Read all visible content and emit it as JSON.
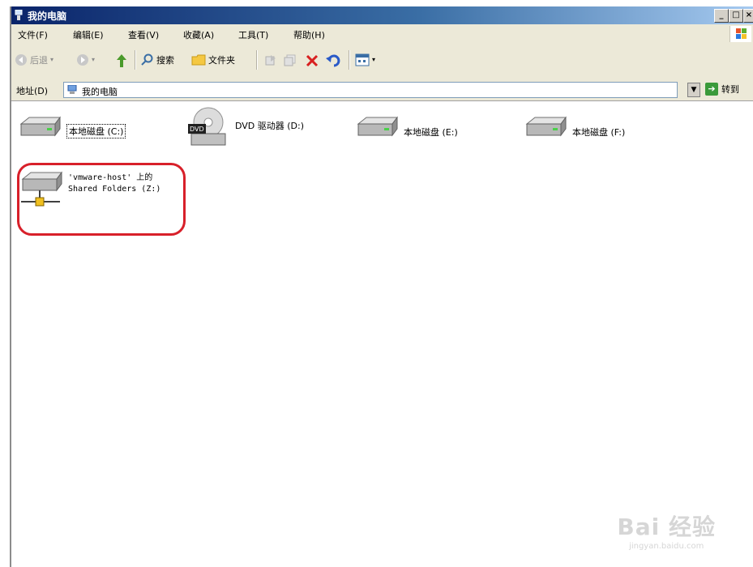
{
  "window": {
    "title": "我的电脑"
  },
  "title_buttons": {
    "minimize": "_",
    "maximize": "□",
    "close": "×"
  },
  "menu": [
    "文件(F)",
    "编辑(E)",
    "查看(V)",
    "收藏(A)",
    "工具(T)",
    "帮助(H)"
  ],
  "toolbar": {
    "back_label": "后退",
    "search_label": "搜索",
    "folders_label": "文件夹"
  },
  "address": {
    "label": "地址(D)",
    "value": "我的电脑",
    "go_label": "转到"
  },
  "drives": [
    {
      "label": "本地磁盘 (C:)",
      "icon": "hard-drive-icon"
    },
    {
      "label": "DVD 驱动器 (D:)",
      "icon": "dvd-drive-icon"
    },
    {
      "label": "本地磁盘 (E:)",
      "icon": "hard-drive-icon"
    },
    {
      "label": "本地磁盘 (F:)",
      "icon": "hard-drive-icon"
    }
  ],
  "network_share": {
    "line1": "'vmware-host' 上的",
    "line2": "Shared Folders (Z:)",
    "icon": "network-drive-icon"
  },
  "watermark": {
    "main": "Bai 经验",
    "sub": "jingyan.baidu.com"
  },
  "colors": {
    "highlight": "#d8202a",
    "titlebar": "#0a246a"
  }
}
